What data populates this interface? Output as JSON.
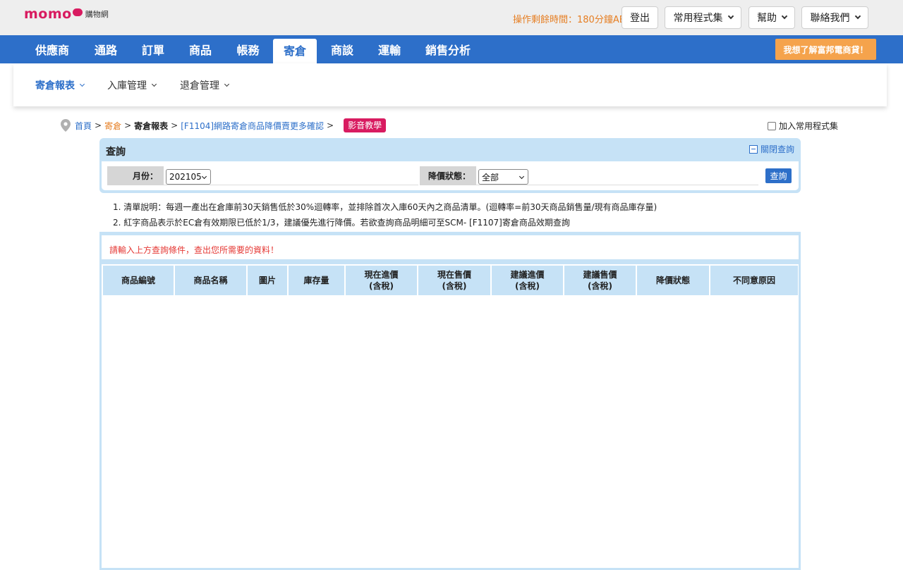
{
  "header": {
    "logo_text": "momo",
    "logo_sub": "購物網",
    "countdown": "操作剩餘時間：180分鐘AE",
    "logout": "登出",
    "favorites": "常用程式集",
    "help": "幫助",
    "contact": "聯絡我們"
  },
  "nav": {
    "items": [
      "供應商",
      "通路",
      "訂單",
      "商品",
      "帳務",
      "寄倉",
      "商談",
      "運輸",
      "銷售分析"
    ],
    "active": "寄倉",
    "cta": "我想了解富邦電商貸！"
  },
  "subnav": {
    "items": [
      "寄倉報表",
      "入庫管理",
      "退倉管理"
    ],
    "active": "寄倉報表"
  },
  "breadcrumb": {
    "home": "首頁",
    "section": "寄倉",
    "report": "寄倉報表",
    "page": "[F1104]網路寄倉商品降價賣更多確認",
    "sep": ">",
    "video": "影音教學",
    "add_favorite": "加入常用程式集"
  },
  "query": {
    "title": "查詢",
    "collapse": "關閉查詢",
    "month_label": "月份：",
    "month_value": "202105",
    "status_label": "降價狀態：",
    "status_value": "全部",
    "submit": "查詢"
  },
  "notes": [
    "1. 清單說明：每週一產出在倉庫前30天銷售低於30%迴轉率，並排除首次入庫60天內之商品清單。(迴轉率=前30天商品銷售量/現有商品庫存量)",
    "2. 紅字商品表示於EC倉有效期限已低於1/3，建議優先進行降價。若欲查詢商品明細可至SCM- [F1107]寄倉商品效期查詢"
  ],
  "results": {
    "message": "請輸入上方查詢條件，查出您所需要的資料！",
    "columns": [
      {
        "l1": "商品編號",
        "l2": ""
      },
      {
        "l1": "商品名稱",
        "l2": ""
      },
      {
        "l1": "圖片",
        "l2": ""
      },
      {
        "l1": "庫存量",
        "l2": ""
      },
      {
        "l1": "現在進價",
        "l2": "(含稅)"
      },
      {
        "l1": "現在售價",
        "l2": "(含稅)"
      },
      {
        "l1": "建議進價",
        "l2": "(含稅)"
      },
      {
        "l1": "建議售價",
        "l2": "(含稅)"
      },
      {
        "l1": "降價狀態",
        "l2": ""
      },
      {
        "l1": "不同意原因",
        "l2": ""
      }
    ]
  },
  "colors": {
    "brand": "#d81b60",
    "nav_blue": "#2d6fc9",
    "panel_blue": "#c6e2f6",
    "cta_orange": "#f5a34c",
    "countdown_orange": "#e67e22",
    "alert_red": "#e53935"
  }
}
